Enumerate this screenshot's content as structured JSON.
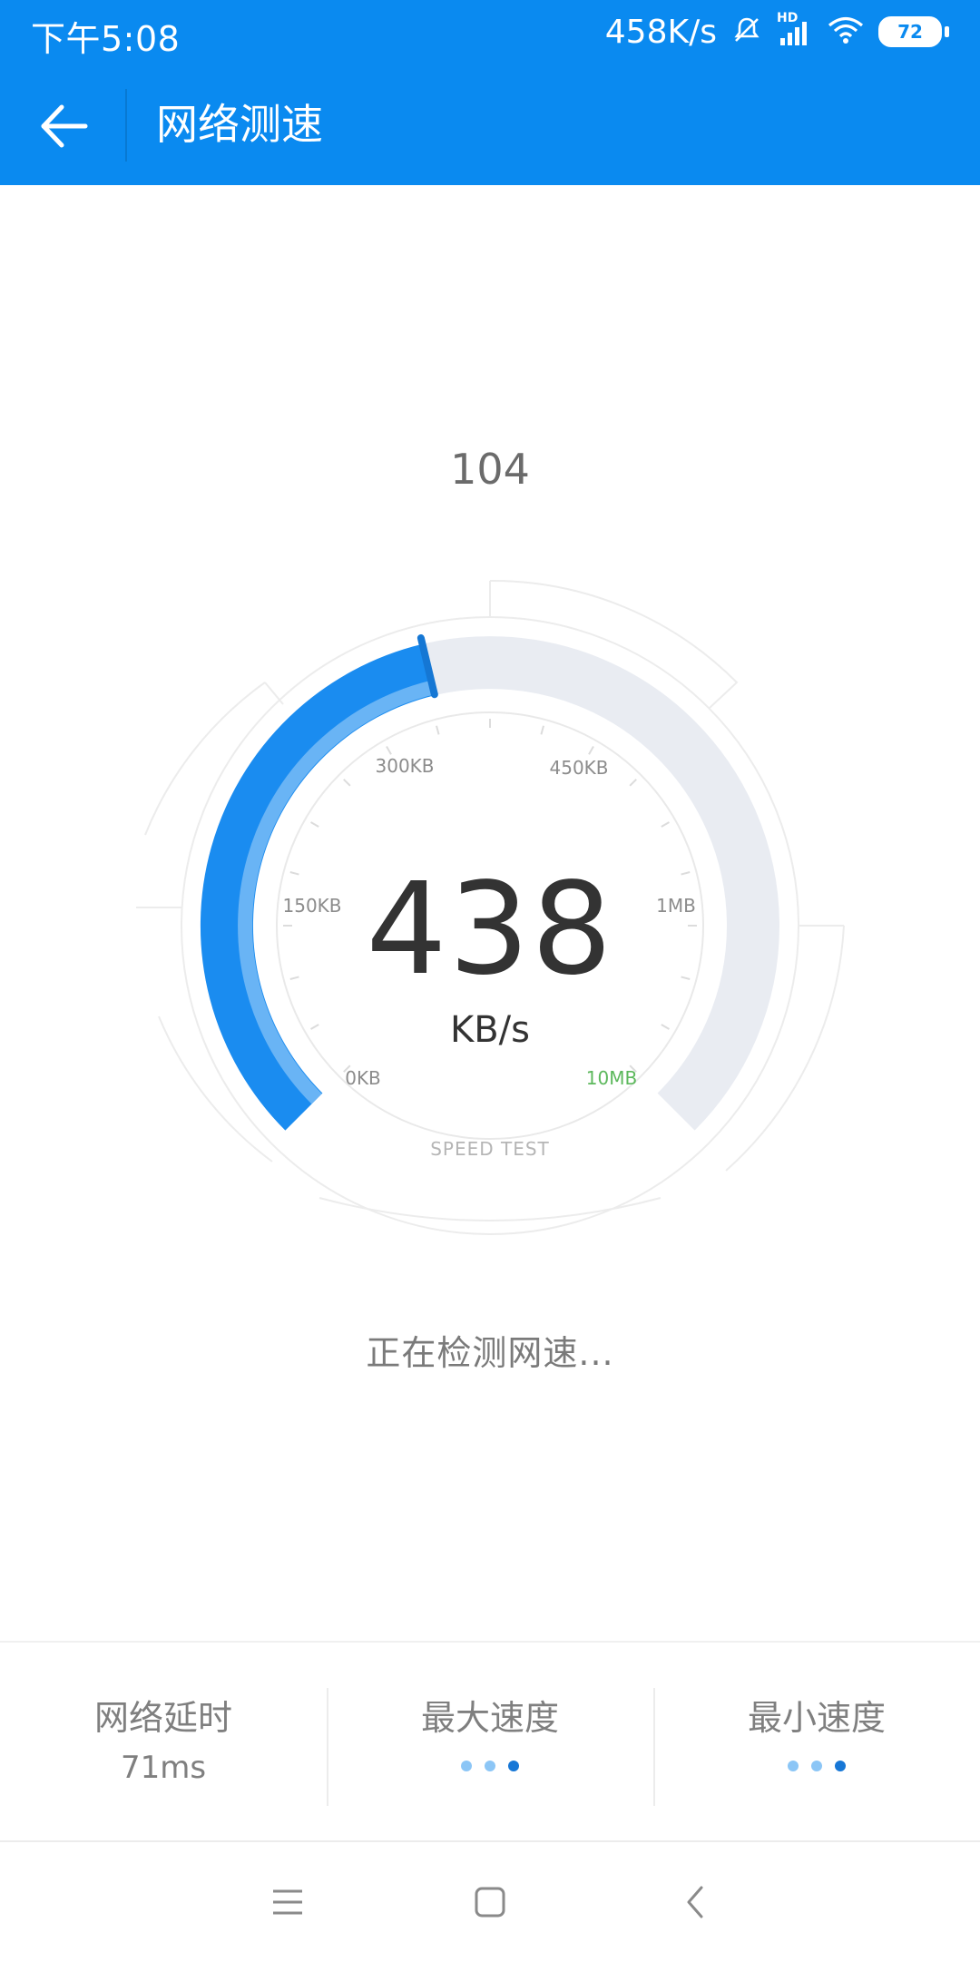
{
  "status_bar": {
    "time": "下午5:08",
    "network_speed": "458K/s",
    "network_type": "HD",
    "battery": "72",
    "icons": [
      "alarm-off-icon",
      "signal-icon",
      "wifi-icon",
      "battery-icon"
    ]
  },
  "app_bar": {
    "title": "网络测速",
    "back_icon": "arrow-left-icon",
    "background": "#0a8af0"
  },
  "gauge": {
    "top_value": "104",
    "speed_value": "438",
    "speed_unit": "KB/s",
    "tick_labels": [
      "0KB",
      "150KB",
      "300KB",
      "450KB",
      "1MB",
      "10MB"
    ],
    "caption": "SPEED TEST",
    "progress_fraction": 0.45,
    "active_color": "#1a8cf0",
    "track_color": "#e9ecf2",
    "end_label_color": "#5cb85c"
  },
  "status_message": "正在检测网速...",
  "stats": [
    {
      "label": "网络延时",
      "value": "71ms"
    },
    {
      "label": "最大速度",
      "value": ""
    },
    {
      "label": "最小速度",
      "value": ""
    }
  ],
  "nav_bar": {
    "icons": [
      "menu-icon",
      "home-square-icon",
      "back-chevron-icon"
    ]
  }
}
